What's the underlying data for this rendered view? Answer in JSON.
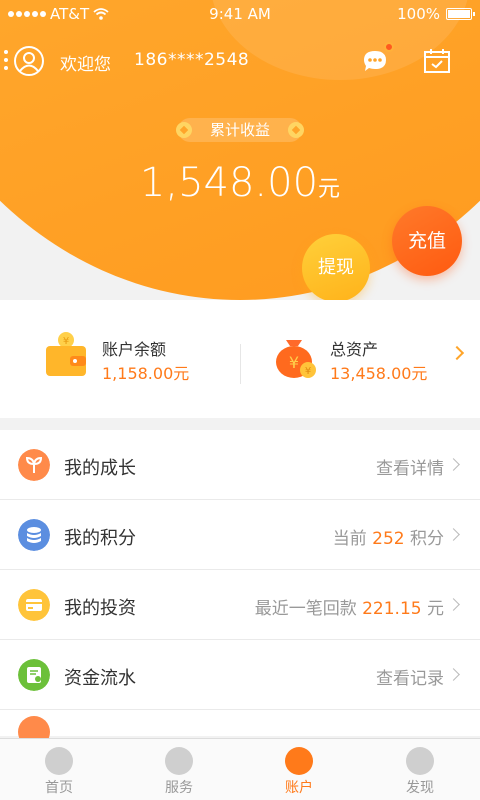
{
  "status_bar": {
    "carrier": "AT&T",
    "time": "9:41 AM",
    "battery": "100%"
  },
  "header": {
    "welcome": "欢迎您",
    "phone": "186****2548",
    "earnings_label": "累计收益",
    "earnings_amount": "1,548.00",
    "earnings_unit": "元",
    "withdraw_label": "提现",
    "recharge_label": "充值"
  },
  "summary": {
    "balance_label": "账户余额",
    "balance_value": "1,158.00元",
    "assets_label": "总资产",
    "assets_value": "13,458.00元"
  },
  "list": {
    "growth": {
      "label": "我的成长",
      "right": "查看详情"
    },
    "points": {
      "label": "我的积分",
      "pre": "当前 ",
      "value": "252",
      "post": " 积分"
    },
    "invest": {
      "label": "我的投资",
      "pre": "最近一笔回款 ",
      "value": "221.15",
      "post": " 元"
    },
    "flow": {
      "label": "资金流水",
      "right": "查看记录"
    }
  },
  "tabs": [
    {
      "label": "首页",
      "icon": "home-icon"
    },
    {
      "label": "服务",
      "icon": "service-icon"
    },
    {
      "label": "账户",
      "icon": "account-icon",
      "active": true
    },
    {
      "label": "发现",
      "icon": "discover-icon"
    }
  ],
  "colors": {
    "accent": "#ff7a1a",
    "header": "#ffa52a",
    "recharge": "#ff5a10",
    "withdraw": "#ffc02a"
  }
}
